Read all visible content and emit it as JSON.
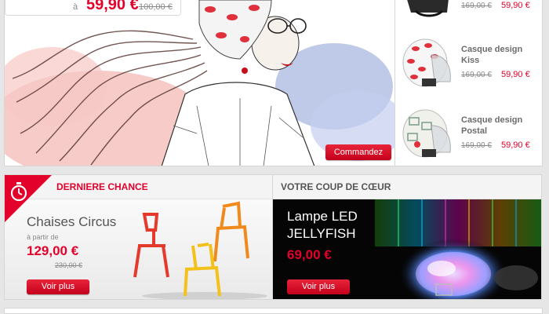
{
  "hero": {
    "price_prefix": "à",
    "price": "59,90 €",
    "old_price": "100,00 €",
    "cta_label": "Commandez"
  },
  "side_products": [
    {
      "name": "",
      "old_price": "169,00 €",
      "price": "59,90 €"
    },
    {
      "name": "Casque design Kiss",
      "old_price": "169,00 €",
      "price": "59,90 €"
    },
    {
      "name": "Casque design Postal",
      "old_price": "169,00 €",
      "price": "59,90 €"
    }
  ],
  "promo_left": {
    "header": "DERNIERE CHANCE",
    "title": "Chaises Circus",
    "from_label": "à partir de",
    "price": "129,00 €",
    "old_price": "230,00 €",
    "cta_label": "Voir plus"
  },
  "promo_right": {
    "header": "VOTRE COUP DE CŒUR",
    "title_line1": "Lampe LED",
    "title_line2": "JELLYFISH",
    "price": "69,00 €",
    "cta_label": "Voir plus"
  },
  "colors": {
    "accent_red": "#e3002b",
    "text_gray": "#555555",
    "panel_bg": "#ffffff",
    "page_bg": "#e6e6e6"
  }
}
